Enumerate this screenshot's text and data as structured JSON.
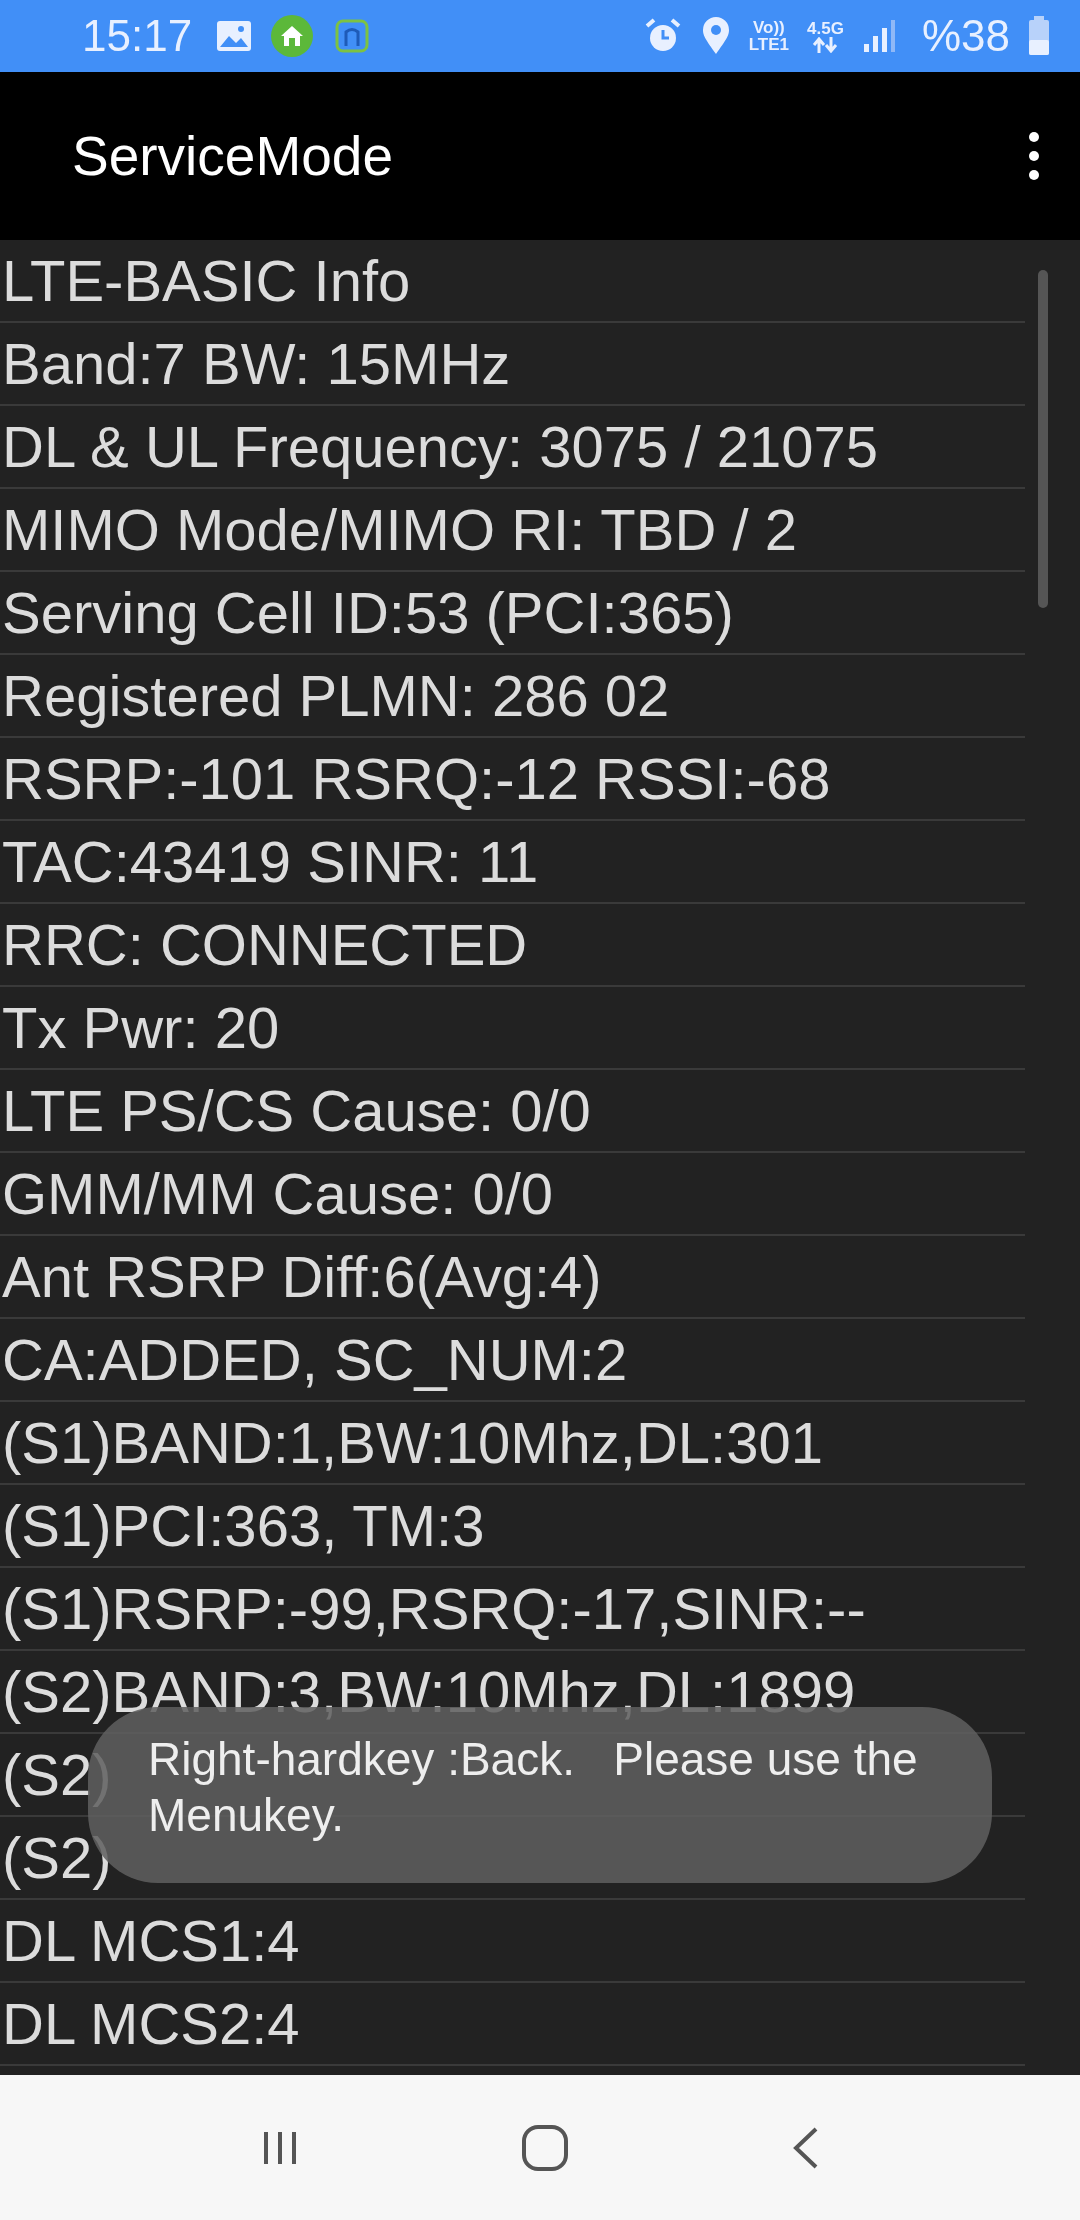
{
  "status_bar": {
    "time": "15:17",
    "volte": "Vo))",
    "lte": "LTE1",
    "network": "4.5G",
    "battery": "%38"
  },
  "app_bar": {
    "title": "ServiceMode"
  },
  "lines": [
    "LTE-BASIC Info",
    "Band:7 BW: 15MHz",
    "DL & UL Frequency: 3075 / 21075",
    "MIMO Mode/MIMO RI: TBD / 2",
    "Serving Cell ID:53 (PCI:365)",
    "Registered PLMN: 286 02",
    "RSRP:-101 RSRQ:-12 RSSI:-68",
    "TAC:43419 SINR: 11",
    "RRC: CONNECTED",
    "Tx Pwr: 20",
    "LTE PS/CS Cause: 0/0",
    "GMM/MM Cause: 0/0",
    "Ant RSRP Diff:6(Avg:4)",
    "CA:ADDED, SC_NUM:2",
    "(S1)BAND:1,BW:10Mhz,DL:301",
    "(S1)PCI:363, TM:3",
    "(S1)RSRP:-99,RSRQ:-17,SINR:--",
    "(S2)BAND:3,BW:10Mhz,DL:1899",
    "(S2)",
    "(S2)",
    "DL MCS1:4",
    "DL MCS2:4"
  ],
  "toast": {
    "text": "Right-hardkey :Back.   Please use the Menukey."
  }
}
